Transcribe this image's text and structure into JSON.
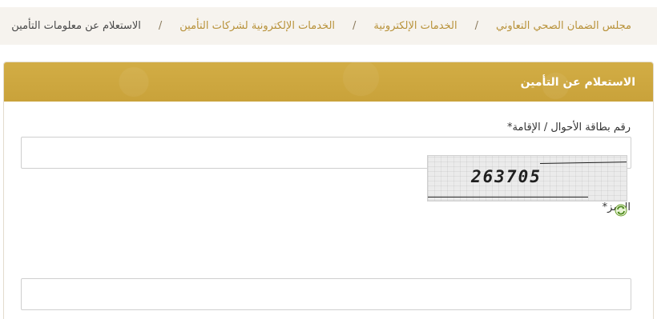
{
  "breadcrumb": {
    "items": [
      "مجلس الضمان الصحي التعاوني",
      "الخدمات الإلكترونية",
      "الخدمات الإلكترونية لشركات التأمين"
    ],
    "separator": "/",
    "current": "الاستعلام عن معلومات التأمين"
  },
  "panel": {
    "title": "الاستعلام عن التأمين"
  },
  "form": {
    "id_label": "رقم بطاقة الأحوال / الإقامة*",
    "id_value": "",
    "captcha_label": "الرمز*",
    "captcha_text": "263705",
    "captcha_value": "",
    "refresh_icon": "refresh-icon"
  },
  "colors": {
    "accent": "#cfa93e",
    "link": "#b8923a",
    "breadcrumb_bg": "#f6f3ee"
  }
}
